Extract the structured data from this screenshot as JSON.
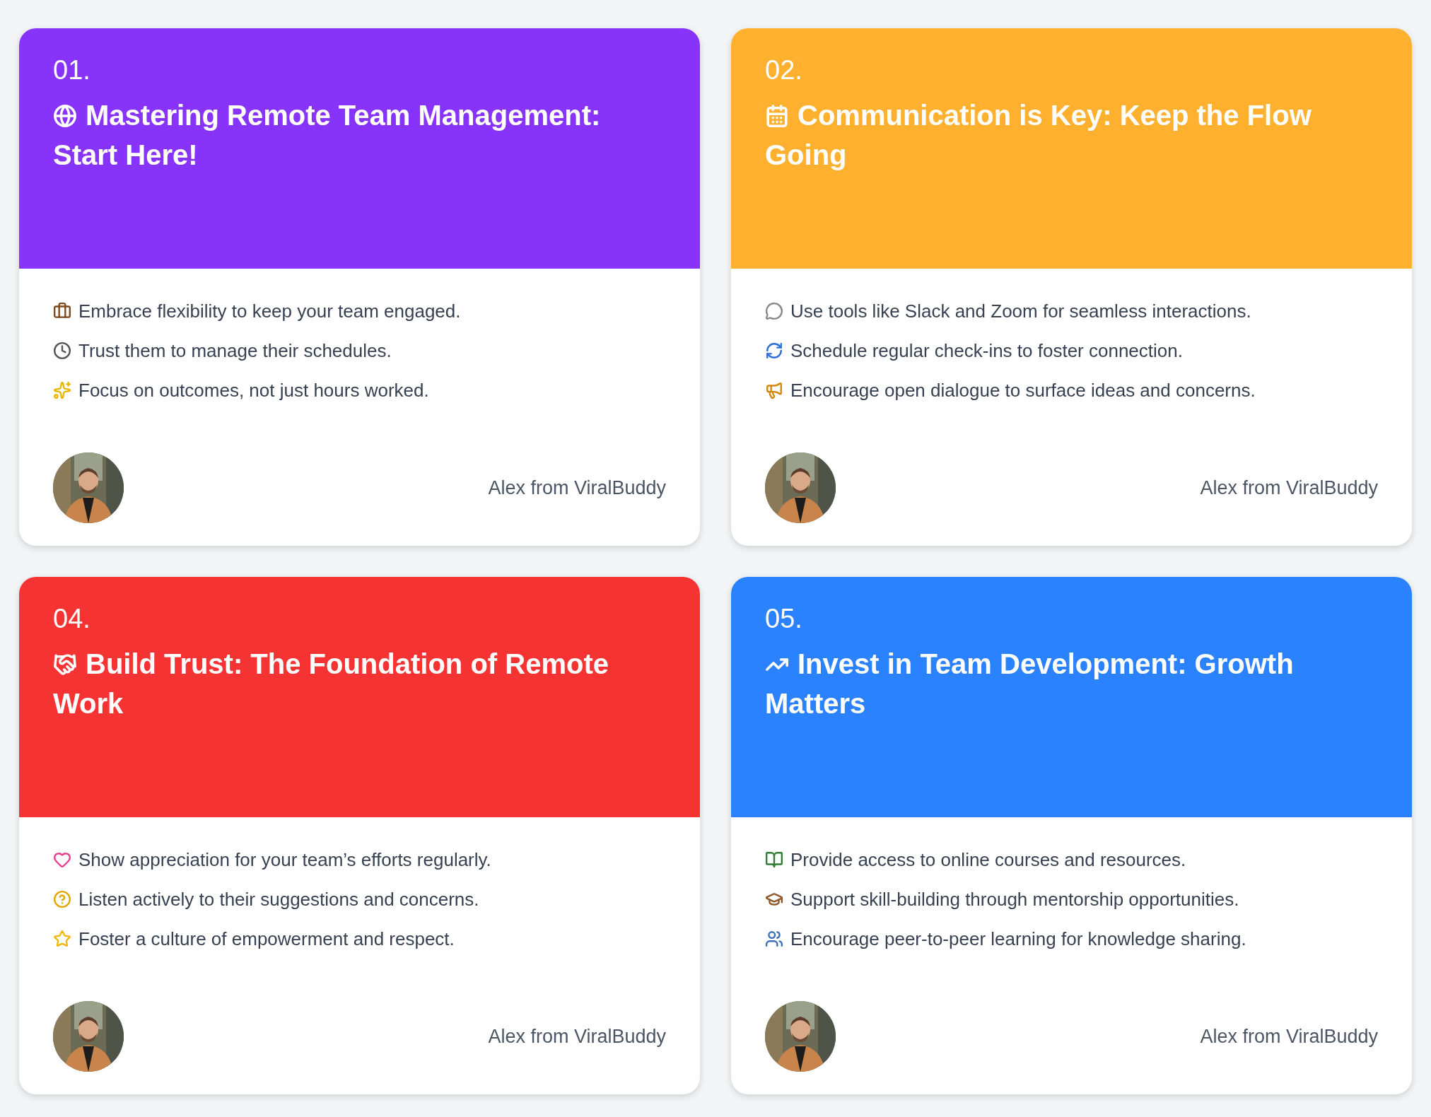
{
  "cards": [
    {
      "number": "01.",
      "title": "Mastering Remote Team Management: Start Here!",
      "color": "#8833f9",
      "points": [
        "Embrace flexibility to keep your team engaged.",
        "Trust them to manage their schedules.",
        "Focus on outcomes, not just hours worked."
      ],
      "author": "Alex from ViralBuddy"
    },
    {
      "number": "02.",
      "title": "Communication is Key: Keep the Flow Going",
      "color": "#ffb02e",
      "points": [
        "Use tools like Slack and Zoom for seamless interactions.",
        "Schedule regular check-ins to foster connection.",
        "Encourage open dialogue to surface ideas and concerns."
      ],
      "author": "Alex from ViralBuddy"
    },
    {
      "number": "04.",
      "title": "Build Trust: The Foundation of Remote Work",
      "color": "#f63333",
      "points": [
        "Show appreciation for your team’s efforts regularly.",
        "Listen actively to their suggestions and concerns.",
        "Foster a culture of empowerment and respect."
      ],
      "author": "Alex from ViralBuddy"
    },
    {
      "number": "05.",
      "title": "Invest in Team Development: Growth Matters",
      "color": "#2b82ff",
      "points": [
        "Provide access to online courses and resources.",
        "Support skill-building through mentorship opportunities.",
        "Encourage peer-to-peer learning for knowledge sharing."
      ],
      "author": "Alex from ViralBuddy"
    }
  ]
}
